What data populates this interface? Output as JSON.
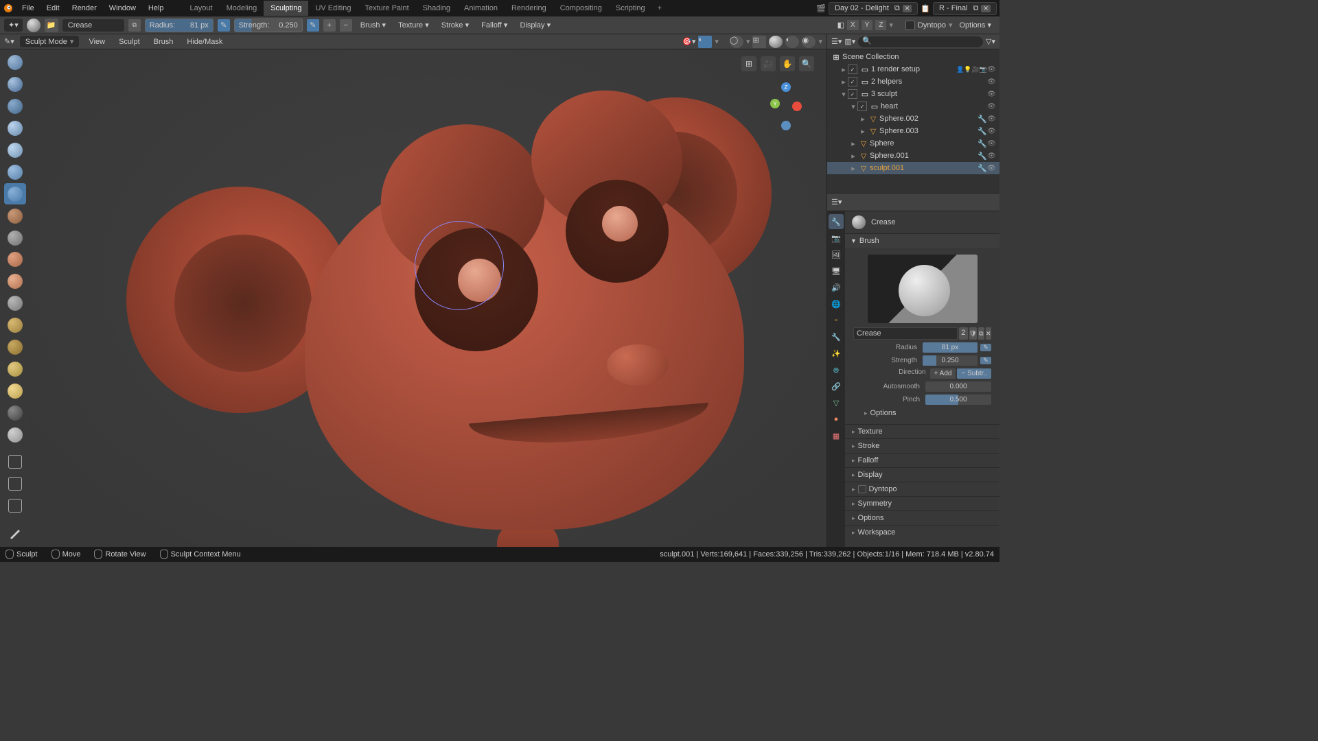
{
  "topmenu": {
    "file": "File",
    "edit": "Edit",
    "render": "Render",
    "window": "Window",
    "help": "Help"
  },
  "workspaces": [
    "Layout",
    "Modeling",
    "Sculpting",
    "UV Editing",
    "Texture Paint",
    "Shading",
    "Animation",
    "Rendering",
    "Compositing",
    "Scripting"
  ],
  "active_workspace": "Sculpting",
  "scene": {
    "name": "Day 02 - Delight",
    "layer": "R - Final"
  },
  "header": {
    "brush_name": "Crease",
    "radius_label": "Radius:",
    "radius_val": "81 px",
    "strength_label": "Strength:",
    "strength_val": "0.250",
    "brush_menu": "Brush",
    "texture_menu": "Texture",
    "stroke_menu": "Stroke",
    "falloff_menu": "Falloff",
    "display_menu": "Display",
    "sym_x": "X",
    "sym_y": "Y",
    "sym_z": "Z",
    "dyntopo": "Dyntopo",
    "options": "Options"
  },
  "header3": {
    "mode": "Sculpt Mode",
    "view": "View",
    "sculpt": "Sculpt",
    "brush": "Brush",
    "hidemask": "Hide/Mask"
  },
  "outliner": {
    "root": "Scene Collection",
    "items": [
      {
        "name": "1 render setup",
        "type": "coll",
        "depth": 1,
        "checked": true,
        "arrow": "▸",
        "extras": "👤💡🎥📷"
      },
      {
        "name": "2 helpers",
        "type": "coll",
        "depth": 1,
        "checked": true,
        "arrow": "▸"
      },
      {
        "name": "3 sculpt",
        "type": "coll",
        "depth": 1,
        "checked": true,
        "arrow": "▾"
      },
      {
        "name": "heart",
        "type": "coll",
        "depth": 2,
        "checked": true,
        "arrow": "▾"
      },
      {
        "name": "Sphere.002",
        "type": "mesh",
        "depth": 3,
        "arrow": "▸",
        "mod": true
      },
      {
        "name": "Sphere.003",
        "type": "mesh",
        "depth": 3,
        "arrow": "▸",
        "mod": true
      },
      {
        "name": "Sphere",
        "type": "mesh",
        "depth": 2,
        "arrow": "▸",
        "mod": true
      },
      {
        "name": "Sphere.001",
        "type": "mesh",
        "depth": 2,
        "arrow": "▸",
        "mod": true
      },
      {
        "name": "sculpt.001",
        "type": "mesh",
        "depth": 2,
        "arrow": "▸",
        "mod": true,
        "active": true
      }
    ]
  },
  "props": {
    "tool_name": "Crease",
    "brush_header": "Brush",
    "brush_field": "Crease",
    "brush_num": "2",
    "radius_label": "Radius",
    "radius_val": "81 px",
    "strength_label": "Strength",
    "strength_val": "0.250",
    "direction_label": "Direction",
    "dir_add": "+  Add",
    "dir_sub": "−  Subtr..",
    "autosmooth_label": "Autosmooth",
    "autosmooth_val": "0.000",
    "pinch_label": "Pinch",
    "pinch_val": "0.500",
    "sections": [
      "Options",
      "Texture",
      "Stroke",
      "Falloff",
      "Display",
      "Dyntopo",
      "Symmetry",
      "Options",
      "Workspace"
    ]
  },
  "status": {
    "sculpt": "Sculpt",
    "move": "Move",
    "rotate": "Rotate View",
    "context": "Sculpt Context Menu",
    "stats": "sculpt.001 | Verts:169,641 | Faces:339,256 | Tris:339,262 | Objects:1/16 | Mem: 718.4 MB | v2.80.74"
  }
}
